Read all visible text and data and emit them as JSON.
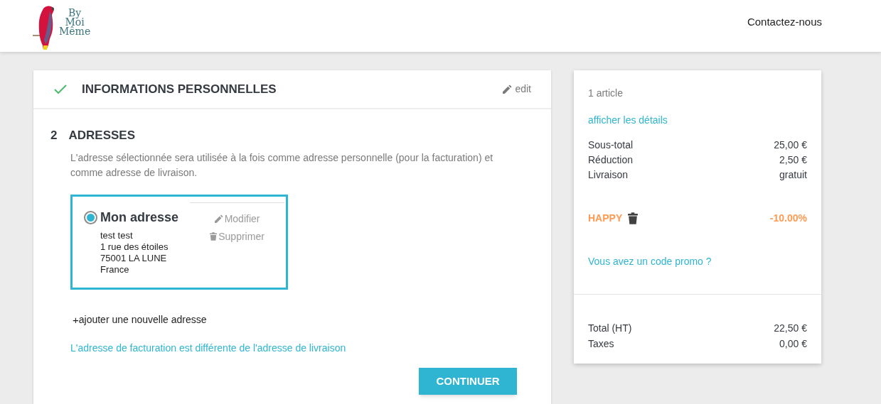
{
  "header": {
    "logo_lines": [
      "By",
      "Moi",
      "Même"
    ],
    "contact_link": "Contactez-nous"
  },
  "steps": [
    {
      "kind": "done",
      "title": "INFORMATIONS PERSONNELLES",
      "edit": "edit"
    },
    {
      "kind": "current",
      "number": "2",
      "title": "ADRESSES",
      "description": "L'adresse sélectionnée sera utilisée à la fois comme adresse personnelle (pour la facturation) et comme adresse de livraison.",
      "addresses": [
        {
          "selected": true,
          "alias": "Mon adresse",
          "lines": [
            "test test",
            "1 rue des étoiles",
            "75001 LA LUNE",
            "France"
          ],
          "modify": "Modifier",
          "delete": "Supprimer"
        }
      ],
      "add_icon": "+",
      "add_address": "ajouter une nouvelle adresse",
      "different_billing": "L'adresse de facturation est différente de l'adresse de livraison",
      "continue": "CONTINUER"
    }
  ],
  "summary": {
    "count": "1 article",
    "details_link": "afficher les détails",
    "lines": [
      {
        "label": "Sous-total",
        "value": "25,00 €"
      },
      {
        "label": "Réduction",
        "value": "2,50 €"
      },
      {
        "label": "Livraison",
        "value": "gratuit"
      }
    ],
    "voucher": {
      "code": "HAPPY",
      "value": "-10.00%"
    },
    "promo_link": "Vous avez un code promo ?",
    "totals": [
      {
        "label": "Total (HT)",
        "value": "22,50 €"
      },
      {
        "label": "Taxes",
        "value": "0,00 €"
      }
    ]
  }
}
